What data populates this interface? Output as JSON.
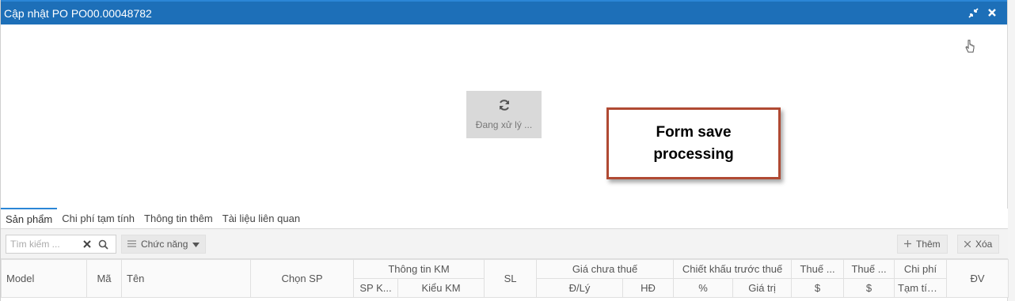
{
  "window": {
    "title": "Cập nhật PO PO00.00048782"
  },
  "processing": {
    "label": "Đang xử lý ..."
  },
  "callout": {
    "text": "Form save\nprocessing"
  },
  "tabs": [
    {
      "label": "Sản phẩm",
      "active": true
    },
    {
      "label": "Chi phí tạm tính",
      "active": false
    },
    {
      "label": "Thông tin thêm",
      "active": false
    },
    {
      "label": "Tài liệu liên quan",
      "active": false
    }
  ],
  "toolbar": {
    "search_placeholder": "Tìm kiếm ...",
    "function_label": "Chức năng",
    "add_label": "Thêm",
    "delete_label": "Xóa"
  },
  "grid": {
    "headers": {
      "model": "Model",
      "ma": "Mã",
      "ten": "Tên",
      "chon_sp": "Chọn SP",
      "thong_tin_km": "Thông tin KM",
      "sp_k": "SP K...",
      "kieu_km": "Kiểu KM",
      "sl": "SL",
      "gia_chua_thue": "Giá chưa thuế",
      "d_ly": "Đ/Lý",
      "hd": "HĐ",
      "chiet_khau": "Chiết khấu trước thuế",
      "percent": "%",
      "gia_tri": "Giá trị",
      "thue1": "Thuế ...",
      "thue1_unit": "$",
      "thue2": "Thuế ...",
      "thue2_unit": "$",
      "chi_phi": "Chi phí",
      "tam_tinh": "Tạm tính ...",
      "dv": "ĐV"
    }
  },
  "icons": {
    "minimize": "shrink-icon",
    "close": "close-icon",
    "refresh": "refresh-icon",
    "search": "search-icon",
    "clear": "clear-icon",
    "menu": "hamburger-icon",
    "caret": "caret-down-icon",
    "add": "plus-icon",
    "delete": "x-icon",
    "cursor": "hand-cursor-icon"
  },
  "colors": {
    "titlebar": "#1d6fb8",
    "callout_border": "#b04a33",
    "active_tab": "#2b86d6"
  }
}
